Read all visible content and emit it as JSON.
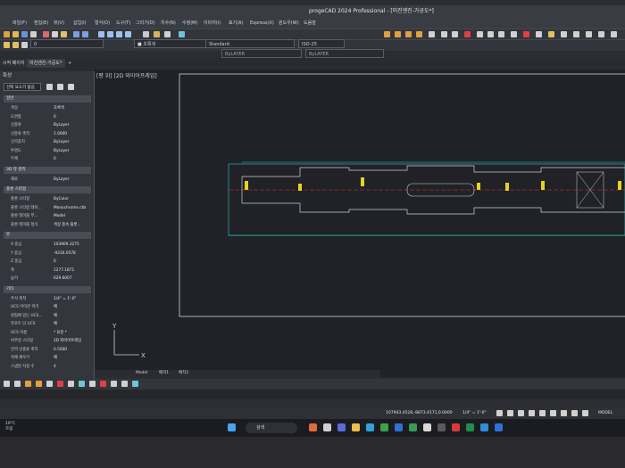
{
  "app": {
    "title": "progeCAD 2024 Professional - [미진엔진-가공도*]",
    "menus": [
      "파일(F)",
      "편집(E)",
      "뷰(V)",
      "삽입(I)",
      "형식(O)",
      "도구(T)",
      "그리기(D)",
      "치수(N)",
      "수정(M)",
      "이미지(I)",
      "표기(A)",
      "Express(X)",
      "윈도우(W)",
      "도움말"
    ]
  },
  "toolbar": {
    "layer_current": "0",
    "color_value": "■ 초록색",
    "style_value": "Standard",
    "dim_style_value": "ISO-25",
    "linetype_value": "ByLAYER",
    "lineweight_value": "ByLAYER"
  },
  "tabs": {
    "start": "시작 페이지",
    "document": "미진엔진-가공도*"
  },
  "properties": {
    "header": "특성",
    "selection": "선택 요소가 없음",
    "groups": {
      "general": "일반",
      "view3d": "3D 뷰 관리",
      "plot": "플롯 스타일",
      "view": "뷰",
      "misc": "기타"
    },
    "general_rows": [
      {
        "key": "색상",
        "value": "초록색"
      },
      {
        "key": "도면층",
        "value": "0"
      },
      {
        "key": "선종류",
        "value": "ByLayer"
      },
      {
        "key": "선종류 축척",
        "value": "1.0000"
      },
      {
        "key": "선가중치",
        "value": "ByLayer"
      },
      {
        "key": "투명도",
        "value": "ByLayer"
      },
      {
        "key": "두께",
        "value": "0"
      }
    ],
    "view3d_rows": [
      {
        "key": "재료",
        "value": "ByLayer"
      }
    ],
    "plot_rows": [
      {
        "key": "플롯 스타일",
        "value": "ByColor"
      },
      {
        "key": "플롯 스타일 테이...",
        "value": "Monochrome.ctb"
      },
      {
        "key": "플롯 테이블 부...",
        "value": "Model"
      },
      {
        "key": "플롯 테이블 형식",
        "value": "색상 종속 플롯..."
      }
    ],
    "view_rows": [
      {
        "key": "X 중심",
        "value": "103909.3275"
      },
      {
        "key": "Y 중심",
        "value": "-9216.0578"
      },
      {
        "key": "Z 중심",
        "value": "0"
      },
      {
        "key": "폭",
        "value": "1277.1871"
      },
      {
        "key": "높이",
        "value": "629.6007"
      }
    ],
    "misc_rows": [
      {
        "key": "주석 축척",
        "value": "1/4\" = 1'-0\""
      },
      {
        "key": "UCS 아이콘 켜기",
        "value": "예"
      },
      {
        "key": "원점에 있는 UCS...",
        "value": "예"
      },
      {
        "key": "뷰포트 당 UCS",
        "value": "예"
      },
      {
        "key": "UCS 이름",
        "value": "* 표준 *"
      },
      {
        "key": "비주얼 스타일",
        "value": "2D 와이어프레임"
      },
      {
        "key": "전역 선종류 축척",
        "value": "0.5000"
      },
      {
        "key": "객체 채우기",
        "value": "예"
      },
      {
        "key": "스냅된 지정 수",
        "value": "4"
      }
    ]
  },
  "canvas": {
    "view_label": "[평 위] [2D 와이어프레임]",
    "axis_y": "Y",
    "axis_x": "X"
  },
  "layout_tabs": [
    "Model",
    "배치1",
    "배치2"
  ],
  "status": {
    "coords": "107943.4528,-8873.4171,0.0000",
    "scale": "1/4\" = 1'-0\"",
    "model": "MODEL"
  },
  "taskbar": {
    "weather_temp": "19°C",
    "weather_desc": "흐림",
    "search_placeholder": "검색"
  },
  "colors": {
    "accent_green": "#2ecc40",
    "drawing_cyan": "#33c6c8",
    "drawing_yellow": "#e8d21c",
    "drawing_red": "#e03030",
    "drawing_white": "#d0d0d0"
  }
}
